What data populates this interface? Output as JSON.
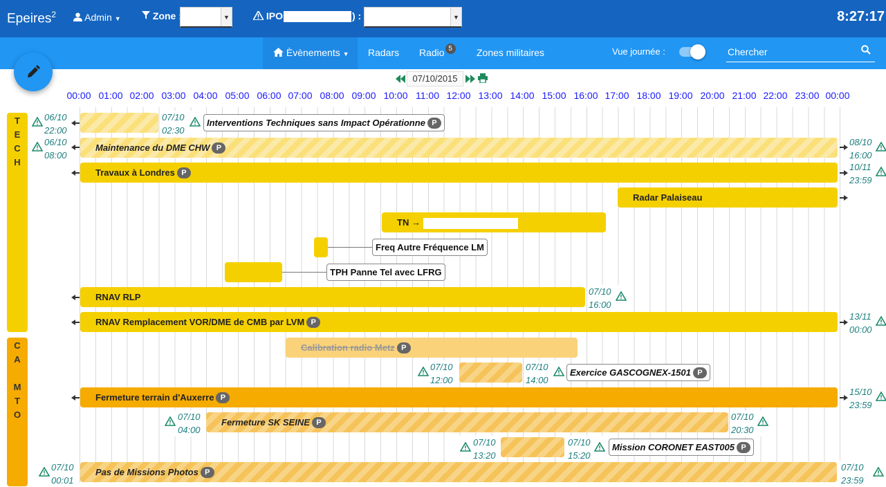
{
  "header": {
    "brand": "Epeires",
    "brand_sup": "2",
    "user": "Admin",
    "zone_label": "Zone :",
    "ipo_label": "IPO",
    "ipo_close": ") :",
    "clock": "8:27:17"
  },
  "nav": {
    "items": [
      {
        "label": "Èvènements",
        "active": true
      },
      {
        "label": "Radars"
      },
      {
        "label": "Radio",
        "badge": "5"
      },
      {
        "label": "Zones militaires"
      }
    ],
    "toggle_label": "Vue journée :",
    "toggle_on": true,
    "search_placeholder": "Chercher"
  },
  "timeline": {
    "date": "07/10/2015",
    "hours": [
      "00:00",
      "01:00",
      "02:00",
      "03:00",
      "04:00",
      "05:00",
      "06:00",
      "07:00",
      "08:00",
      "09:00",
      "10:00",
      "11:00",
      "12:00",
      "13:00",
      "14:00",
      "15:00",
      "16:00",
      "17:00",
      "18:00",
      "19:00",
      "20:00",
      "21:00",
      "22:00",
      "23:00",
      "00:00"
    ]
  },
  "categories": [
    {
      "label": "T E C H",
      "color": "#f5d000"
    },
    {
      "label": "C A M T O",
      "color": "#f5ab00"
    }
  ],
  "events": {
    "e1": {
      "label": "Interventions Techniques sans Impact Opérationne",
      "badge": "P",
      "start_date": "06/10",
      "start_time": "22:00",
      "end_date": "07/10",
      "end_time": "02:30"
    },
    "e2": {
      "label": "Maintenance du DME CHW",
      "badge": "P",
      "start_date": "06/10",
      "start_time": "08:00",
      "end_date": "08/10",
      "end_time": "16:00"
    },
    "e3": {
      "label": "Travaux à Londres",
      "badge": "P",
      "end_date": "10/11",
      "end_time": "23:59"
    },
    "e4": {
      "label": "Radar Palaiseau"
    },
    "e5": {
      "label": "TN →"
    },
    "e6": {
      "label": "Freq Autre Fréquence LM"
    },
    "e7": {
      "label": "TPH Panne Tel avec LFRG"
    },
    "e8": {
      "label": "RNAV RLP",
      "end_date": "07/10",
      "end_time": "16:00"
    },
    "e9": {
      "label": "RNAV Remplacement VOR/DME de CMB par LVM",
      "badge": "P",
      "end_date": "13/11",
      "end_time": "00:00"
    },
    "e10": {
      "label": "Calibration radio Metz",
      "badge": "P"
    },
    "e11": {
      "label": "Exercice GASCOGNEX-1501",
      "badge": "P",
      "start_date": "07/10",
      "start_time": "12:00",
      "end_date": "07/10",
      "end_time": "14:00"
    },
    "e12": {
      "label": "Fermeture terrain d'Auxerre",
      "badge": "P",
      "end_date": "15/10",
      "end_time": "23:59"
    },
    "e13": {
      "label": "Fermeture SK SEINE",
      "badge": "P",
      "start_date": "07/10",
      "start_time": "04:00",
      "end_date": "07/10",
      "end_time": "20:30"
    },
    "e14": {
      "label": "Mission CORONET EAST005",
      "badge": "P",
      "start_date": "07/10",
      "start_time": "13:20",
      "end_date": "07/10",
      "end_time": "15:20"
    },
    "e15": {
      "label": "Pas de Missions Photos",
      "badge": "P",
      "start_date": "07/10",
      "start_time": "00:01",
      "end_date": "07/10",
      "end_time": "23:59"
    }
  },
  "colors": {
    "header": "#1565c0",
    "nav": "#2196f3",
    "yellow": "#f5d000",
    "orange": "#f5ab00",
    "hour_text": "#1a1aff",
    "datetime_text": "#1f7f7f"
  }
}
